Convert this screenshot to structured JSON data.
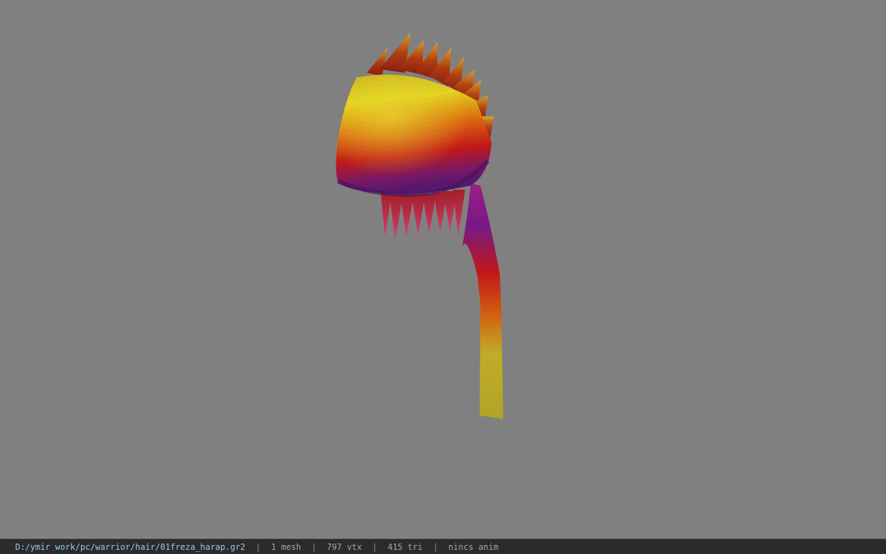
{
  "viewer": {
    "background_color": "#808080",
    "model_colors": {
      "yellow": "#e0d020",
      "orange": "#e06010",
      "red": "#c81010",
      "purple": "#7a1a8a",
      "magenta": "#b0208a"
    }
  },
  "status_bar": {
    "file_path": "D:/ymir work/pc/warrior/hair/01freza_harap.gr2",
    "separator": "|",
    "mesh_count": "1 mesh",
    "vertex_count": "797 vtx",
    "triangle_count": "415 tri",
    "anim_status": "nincs anim"
  }
}
